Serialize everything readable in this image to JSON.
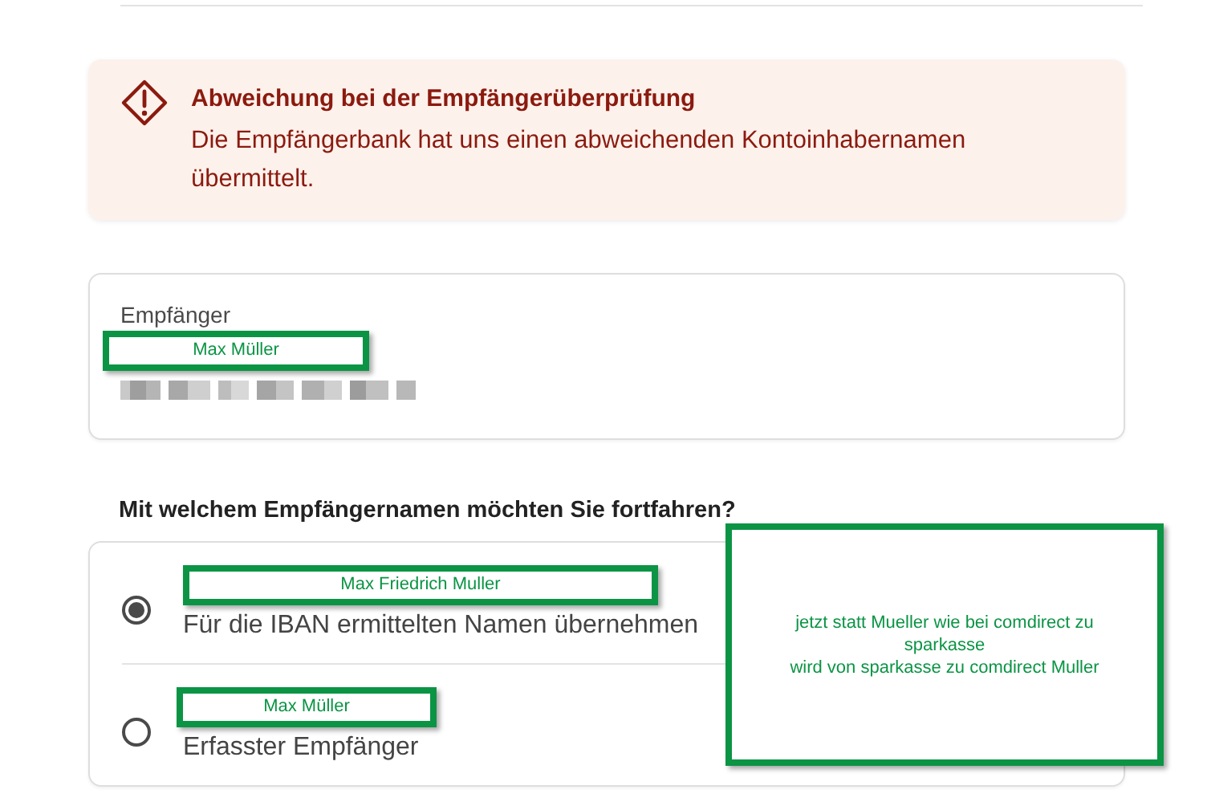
{
  "alert": {
    "title": "Abweichung bei der Empfängerüberprüfung",
    "message": "Die Empfängerbank hat uns einen abweichenden Kontoinhabernamen übermittelt."
  },
  "recipient": {
    "label": "Empfänger",
    "annotation": "Max Müller"
  },
  "question": "Mit welchem Empfängernamen möchten Sie fortfahren?",
  "options": [
    {
      "annotation": "Max Friedrich Muller",
      "label": "Für die IBAN ermittelten Namen übernehmen",
      "selected": true
    },
    {
      "annotation": "Max Müller",
      "label": "Erfasster Empfänger",
      "selected": false
    }
  ],
  "note": {
    "lines": [
      "jetzt statt Mueller wie bei comdirect zu sparkasse",
      "wird von sparkasse zu comdirect Muller"
    ]
  }
}
